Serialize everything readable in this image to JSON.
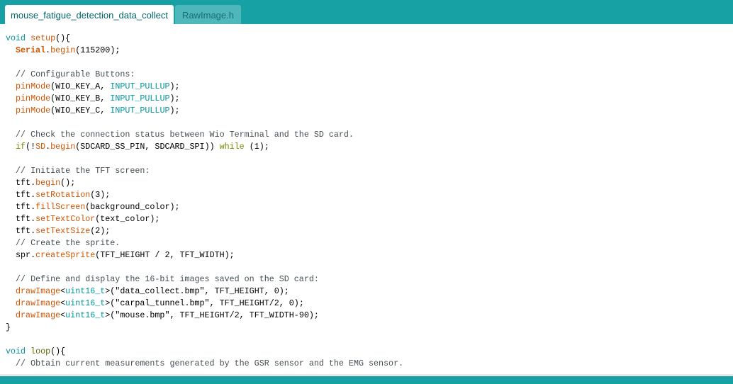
{
  "tabs": [
    {
      "label": "mouse_fatigue_detection_data_collect",
      "active": true
    },
    {
      "label": "RawImage.h",
      "active": false
    }
  ],
  "colors": {
    "accent": "#17a1a5",
    "keyword": "#00979c",
    "function": "#d35400",
    "control": "#728e00",
    "comment": "#434f54"
  },
  "code_lines": [
    [
      [
        "void",
        "kw"
      ],
      [
        " "
      ],
      [
        "setup",
        "fn"
      ],
      [
        "(){"
      ]
    ],
    [
      [
        "  "
      ],
      [
        "Serial",
        "cls"
      ],
      [
        "."
      ],
      [
        "begin",
        "fn"
      ],
      [
        "(115200);"
      ]
    ],
    [],
    [
      [
        "  // Configurable Buttons:",
        "cm"
      ]
    ],
    [
      [
        "  "
      ],
      [
        "pinMode",
        "fn"
      ],
      [
        "(WIO_KEY_A, "
      ],
      [
        "INPUT_PULLUP",
        "kw"
      ],
      [
        ");"
      ]
    ],
    [
      [
        "  "
      ],
      [
        "pinMode",
        "fn"
      ],
      [
        "(WIO_KEY_B, "
      ],
      [
        "INPUT_PULLUP",
        "kw"
      ],
      [
        ");"
      ]
    ],
    [
      [
        "  "
      ],
      [
        "pinMode",
        "fn"
      ],
      [
        "(WIO_KEY_C, "
      ],
      [
        "INPUT_PULLUP",
        "kw"
      ],
      [
        ");"
      ]
    ],
    [],
    [
      [
        "  // Check the connection status between Wio Terminal and the SD card.",
        "cm"
      ]
    ],
    [
      [
        "  "
      ],
      [
        "if",
        "ctl"
      ],
      [
        "(!"
      ],
      [
        "SD",
        "fn"
      ],
      [
        "."
      ],
      [
        "begin",
        "fn"
      ],
      [
        "(SDCARD_SS_PIN, SDCARD_SPI)) "
      ],
      [
        "while",
        "ctl"
      ],
      [
        " (1);"
      ]
    ],
    [],
    [
      [
        "  // Initiate the TFT screen:",
        "cm"
      ]
    ],
    [
      [
        "  tft."
      ],
      [
        "begin",
        "fn"
      ],
      [
        "();"
      ]
    ],
    [
      [
        "  tft."
      ],
      [
        "setRotation",
        "fn"
      ],
      [
        "(3);"
      ]
    ],
    [
      [
        "  tft."
      ],
      [
        "fillScreen",
        "fn"
      ],
      [
        "(background_color);"
      ]
    ],
    [
      [
        "  tft."
      ],
      [
        "setTextColor",
        "fn"
      ],
      [
        "(text_color);"
      ]
    ],
    [
      [
        "  tft."
      ],
      [
        "setTextSize",
        "fn"
      ],
      [
        "(2);"
      ]
    ],
    [
      [
        "  // Create the sprite.",
        "cm"
      ]
    ],
    [
      [
        "  spr."
      ],
      [
        "createSprite",
        "fn"
      ],
      [
        "(TFT_HEIGHT / 2, TFT_WIDTH);"
      ]
    ],
    [],
    [
      [
        "  // Define and display the 16-bit images saved on the SD card:",
        "cm"
      ]
    ],
    [
      [
        "  "
      ],
      [
        "drawImage",
        "fn"
      ],
      [
        "<"
      ],
      [
        "uint16_t",
        "kw"
      ],
      [
        ">(\"data_collect.bmp\", TFT_HEIGHT, 0);"
      ]
    ],
    [
      [
        "  "
      ],
      [
        "drawImage",
        "fn"
      ],
      [
        "<"
      ],
      [
        "uint16_t",
        "kw"
      ],
      [
        ">(\"carpal_tunnel.bmp\", TFT_HEIGHT/2, 0);"
      ]
    ],
    [
      [
        "  "
      ],
      [
        "drawImage",
        "fn"
      ],
      [
        "<"
      ],
      [
        "uint16_t",
        "kw"
      ],
      [
        ">(\"mouse.bmp\", TFT_HEIGHT/2, TFT_WIDTH-90);"
      ]
    ],
    [
      [
        "}"
      ]
    ],
    [],
    [
      [
        "void",
        "kw"
      ],
      [
        " "
      ],
      [
        "loop",
        "lp"
      ],
      [
        "(){"
      ]
    ],
    [
      [
        "  // Obtain current measurements generated by the GSR sensor and the EMG sensor.",
        "cm"
      ]
    ]
  ]
}
